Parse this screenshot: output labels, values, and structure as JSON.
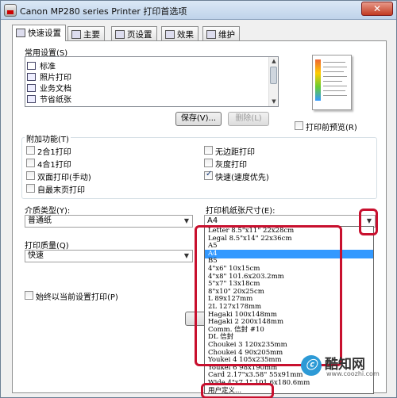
{
  "window": {
    "title": "Canon MP280 series Printer 打印首选项",
    "close_symbol": "✕"
  },
  "tabs": [
    "快速设置",
    "主要",
    "页设置",
    "效果",
    "维护"
  ],
  "common_settings": {
    "label": "常用设置(S)",
    "items": [
      "标准",
      "照片打印",
      "业务文档",
      "节省纸张"
    ],
    "save_button": "保存(V)...",
    "delete_button": "删除(L)"
  },
  "preview_checkbox": "打印前预览(R)",
  "additional_features": {
    "label": "附加功能(T)",
    "left": [
      {
        "label": "2合1打印",
        "checked": false
      },
      {
        "label": "4合1打印",
        "checked": false
      },
      {
        "label": "双面打印(手动)",
        "checked": false
      },
      {
        "label": "自最末页打印",
        "checked": false
      }
    ],
    "right": [
      {
        "label": "无边距打印",
        "checked": false
      },
      {
        "label": "灰度打印",
        "checked": false
      },
      {
        "label": "快速(速度优先)",
        "checked": true
      }
    ]
  },
  "media_type": {
    "label": "介质类型(Y):",
    "value": "普通纸"
  },
  "paper_size": {
    "label": "打印机纸张尺寸(E):",
    "value": "A4"
  },
  "print_quality": {
    "label": "打印质量(Q)",
    "value": "快速"
  },
  "always_print": "始终以当前设置打印(P)",
  "paper_size_options": [
    "Letter 8.5\"x11\" 22x28cm",
    "Legal 8.5\"x14\" 22x36cm",
    "A5",
    "A4",
    "B5",
    "4\"x6\" 10x15cm",
    "4\"x8\" 101.6x203.2mm",
    "5\"x7\" 13x18cm",
    "8\"x10\" 20x25cm",
    "L 89x127mm",
    "2L 127x178mm",
    "Hagaki 100x148mm",
    "Hagaki 2 200x148mm",
    "Comm. 信封 #10",
    "DL 信封",
    "Choukei 3 120x235mm",
    "Choukei 4 90x205mm",
    "Youkei 4 105x235mm",
    "Youkei 6 98x190mm",
    "Card 2.17\"x3.58\" 55x91mm",
    "Wide 4\"x7.1\" 101.6x180.6mm",
    "用户定义..."
  ],
  "selected_paper_size": "A4",
  "watermark": {
    "badge": "ⓒ",
    "title": "酷知网",
    "url": "www.coozhi.com"
  },
  "colors": {
    "highlight": "#3399ff",
    "annotation_red": "#c8102e"
  }
}
